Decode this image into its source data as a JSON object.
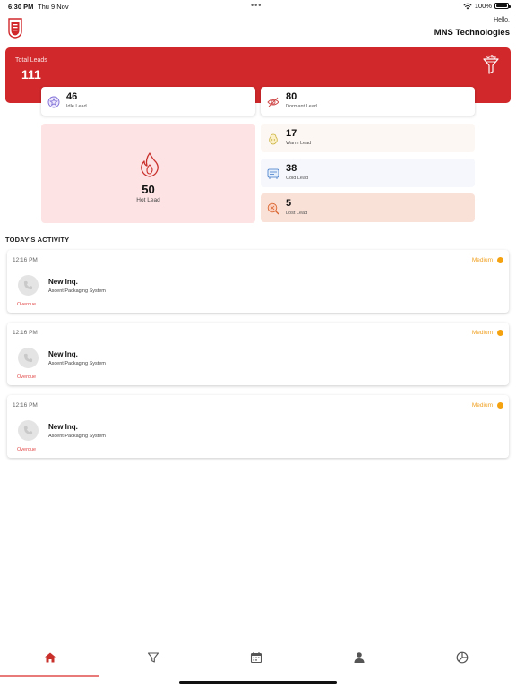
{
  "status_bar": {
    "time": "6:30 PM",
    "date": "Thu 9 Nov",
    "dots": "•••",
    "battery": "100%"
  },
  "header": {
    "greeting": "Hello,",
    "company": "MNS Technologies"
  },
  "total": {
    "label": "Total Leads",
    "value": "111"
  },
  "leads": {
    "idle": {
      "count": "46",
      "label": "Idle Lead"
    },
    "dormant": {
      "count": "80",
      "label": "Dormant Lead"
    },
    "hot": {
      "count": "50",
      "label": "Hot Lead"
    },
    "warm": {
      "count": "17",
      "label": "Warm Lead"
    },
    "cold": {
      "count": "38",
      "label": "Cold Lead"
    },
    "lost": {
      "count": "5",
      "label": "Lost Lead"
    }
  },
  "activity": {
    "title": "TODAY'S ACTIVITY",
    "items": [
      {
        "time": "12:16 PM",
        "priority": "Medium",
        "name": "New Inq.",
        "company": "Ascent Packaging System",
        "status": "Overdue"
      },
      {
        "time": "12:16 PM",
        "priority": "Medium",
        "name": "New Inq.",
        "company": "Ascent Packaging System",
        "status": "Overdue"
      },
      {
        "time": "12:16 PM",
        "priority": "Medium",
        "name": "New Inq.",
        "company": "Ascent Packaging System",
        "status": "Overdue"
      }
    ]
  },
  "nav": {
    "items": [
      "home-icon",
      "filter-icon",
      "calendar-icon",
      "person-icon",
      "dashboard-icon"
    ],
    "active": "home-icon"
  },
  "colors": {
    "brand_red": "#d0282b",
    "priority_medium": "#f4a20f",
    "overdue": "#e24a4a"
  }
}
